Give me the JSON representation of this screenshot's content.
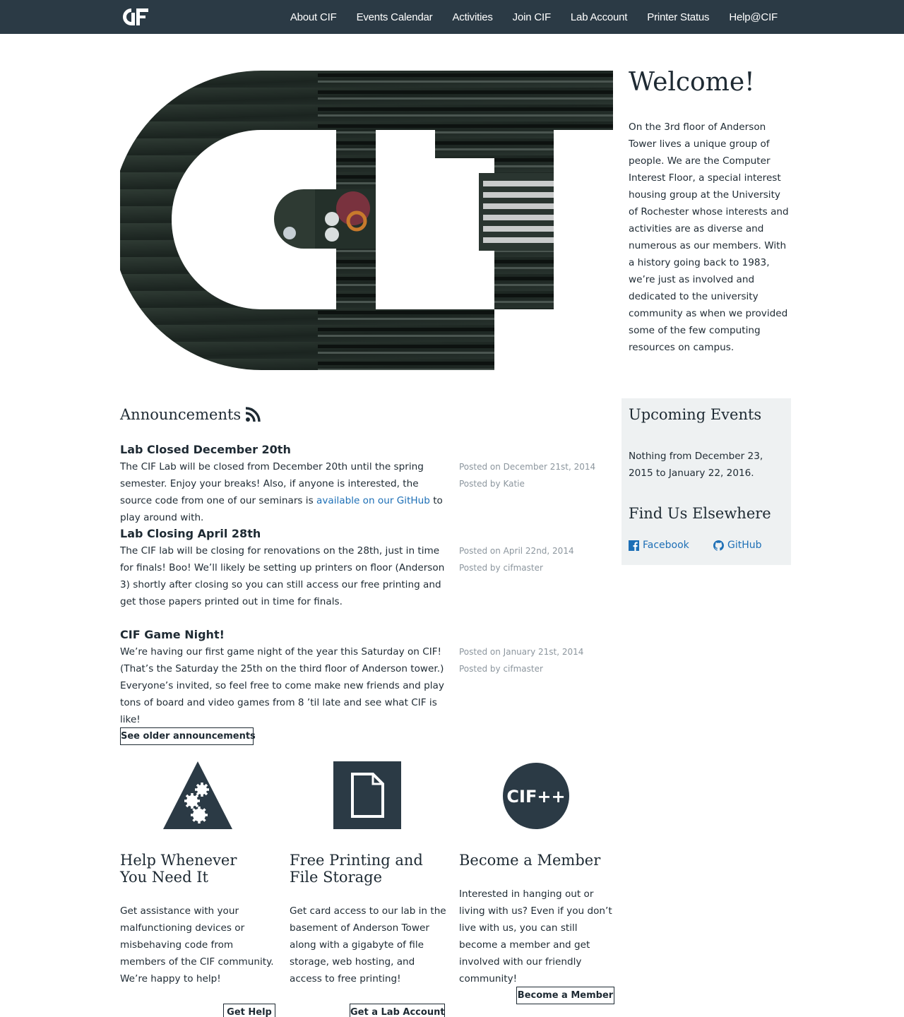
{
  "nav": {
    "brand_logo": "cif-logo",
    "items": [
      "About CIF",
      "Events Calendar",
      "Activities",
      "Join CIF",
      "Lab Account",
      "Printer Status",
      "Help@CIF"
    ]
  },
  "hero": {
    "logo_image": "cif-circuit-board-logo"
  },
  "welcome": {
    "title": "Welcome!",
    "text": "On the 3rd floor of Anderson Tower lives a unique group of people. We are the Computer Interest Floor, a special interest housing group at the University of Rochester whose interests and activities are as diverse and numerous as our members. With a history going back to 1983, we’re just as involved and dedicated to the university community as when we provided some of the few computing resources on campus."
  },
  "announcements": {
    "title": "Announcements",
    "rss_icon": "rss-icon",
    "posts": [
      {
        "title": "Lab Closed December 20th",
        "body_before": "The CIF Lab will be closed from December 20th until the spring semester. Enjoy your breaks! Also, if anyone is interested, the source code from one of our seminars is ",
        "link": "available on our GitHub",
        "body_after": " to play around with.",
        "posted_on": "Posted on December 21st, 2014",
        "posted_by": "Posted by Katie"
      },
      {
        "title": "Lab Closing April 28th",
        "body_before": "The CIF lab will be closing for renovations on the 28th, just in time for finals! Boo! We’ll likely be setting up printers on floor (Anderson 3) shortly after closing so you can still access our free printing and get those papers printed out in time for finals.",
        "posted_on": "Posted on April 22nd, 2014",
        "posted_by": "Posted by cifmaster"
      },
      {
        "title": "CIF Game Night!",
        "body_before": "We’re having our first game night of the year this Saturday on CIF! (That’s the Saturday the 25th on the third floor of Anderson tower.) Everyone’s invited, so feel free to come make new friends and play tons of board and video games from 8 ’til late and see what CIF is like!",
        "posted_on": "Posted on January 21st, 2014",
        "posted_by": "Posted by cifmaster"
      }
    ],
    "older_button": "See older announcements"
  },
  "sidebar": {
    "events_title": "Upcoming Events",
    "events_text": "Nothing from December 23, 2015 to January 22, 2016.",
    "elsewhere_title": "Find Us Elsewhere",
    "facebook": "Facebook",
    "facebook_icon": "facebook-icon",
    "github": "GitHub",
    "github_icon": "github-icon"
  },
  "features": [
    {
      "icon": "gears-triangle-icon",
      "title": "Help Whenever You Need It",
      "text": "Get assistance with your malfunctioning devices or misbehaving code from members of the CIF community. We’re happy to help!",
      "button": "Get Help"
    },
    {
      "icon": "document-icon",
      "title": "Free Printing and File Storage",
      "text": "Get card access to our lab in the basement of Anderson Tower along with a gigabyte of file storage, web hosting, and access to free printing!",
      "button": "Get a Lab Account"
    },
    {
      "icon": "cif-plus-plus-icon",
      "icon_text": "CIF++",
      "title": "Become a Member",
      "text": "Interested in hanging out or living with us? Even if you don’t live with us, you can still become a member and get involved with our friendly community!",
      "button": "Become a Member"
    }
  ],
  "colors": {
    "nav_bg": "#2b3a45",
    "text": "#1e2a33",
    "link": "#1d6fb6",
    "meta": "#8c969e",
    "sidebar_bg": "#eef1f2"
  }
}
